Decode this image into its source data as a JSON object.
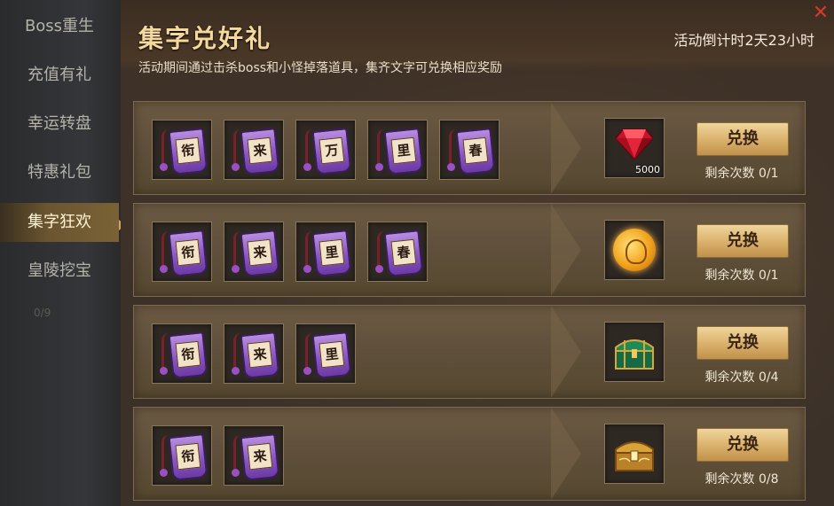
{
  "sidebar": {
    "items": [
      {
        "label": "Boss重生",
        "active": false
      },
      {
        "label": "充值有礼",
        "active": false
      },
      {
        "label": "幸运转盘",
        "active": false
      },
      {
        "label": "特惠礼包",
        "active": false
      },
      {
        "label": "集字狂欢",
        "active": true
      },
      {
        "label": "皇陵挖宝",
        "active": false
      }
    ],
    "faint_text": "0/9"
  },
  "header": {
    "title": "集字兑好礼",
    "subtitle": "活动期间通过击杀boss和小怪掉落道具，集齐文字可兑换相应奖励",
    "countdown": "活动倒计时2天23小时",
    "close_icon": "close-icon"
  },
  "rows": [
    {
      "chars": [
        "衔",
        "来",
        "万",
        "里",
        "春"
      ],
      "reward": {
        "icon": "red-gem-icon",
        "count": "5000"
      },
      "button_label": "兑换",
      "remaining": "剩余次数 0/1"
    },
    {
      "chars": [
        "衔",
        "来",
        "里",
        "春"
      ],
      "reward": {
        "icon": "gold-coin-icon",
        "count": ""
      },
      "button_label": "兑换",
      "remaining": "剩余次数 0/1"
    },
    {
      "chars": [
        "衔",
        "来",
        "里"
      ],
      "reward": {
        "icon": "jade-chest-icon",
        "count": ""
      },
      "button_label": "兑换",
      "remaining": "剩余次数 0/4"
    },
    {
      "chars": [
        "衔",
        "来"
      ],
      "reward": {
        "icon": "gold-chest-icon",
        "count": ""
      },
      "button_label": "兑换",
      "remaining": "剩余次数 0/8"
    }
  ],
  "colors": {
    "title": "#f4d89c",
    "button": "#d9b06a",
    "close": "#d23a2a",
    "tag_purple": "#8a55c4"
  }
}
